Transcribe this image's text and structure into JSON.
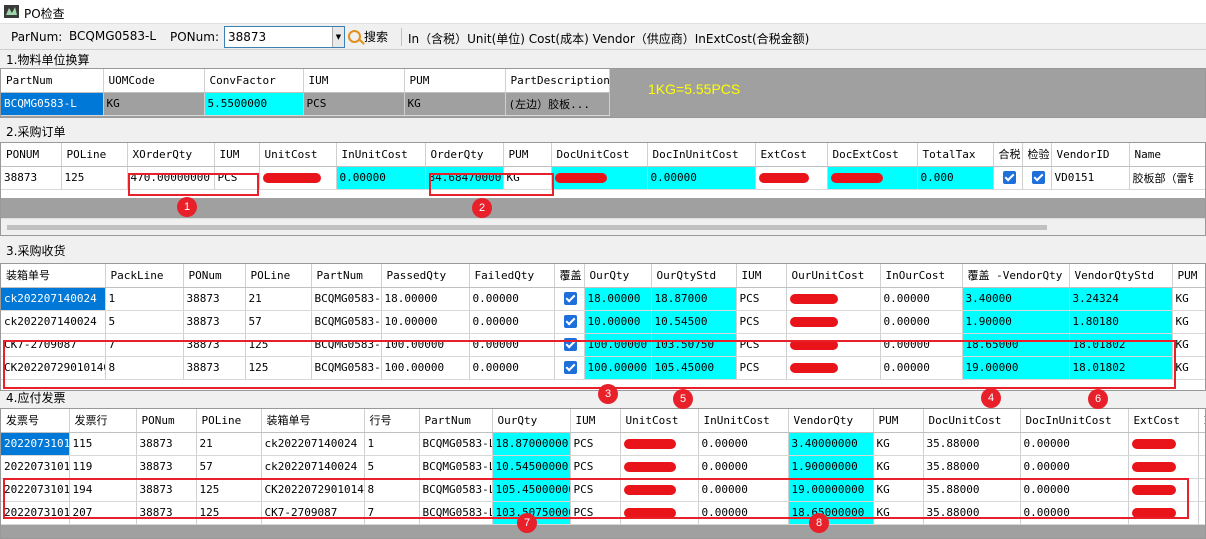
{
  "window": {
    "title": "PO检查"
  },
  "toolbar": {
    "parnum_label": "ParNum:",
    "parnum_value": "BCQMG0583-L",
    "ponum_label": "PONum:",
    "ponum_value": "38873",
    "search_label": "搜索",
    "legend": "In（含税）Unit(单位) Cost(成本) Vendor（供应商）InExtCost(合税金额)"
  },
  "uom": {
    "section": "1.物料单位换算",
    "headers": [
      "PartNum",
      "UOMCode",
      "ConvFactor",
      "IUM",
      "PUM",
      "PartDescription"
    ],
    "row": [
      "BCQMG0583-L",
      "KG",
      "5.5500000",
      "PCS",
      "KG",
      "(左边）胶板..."
    ],
    "note": "1KG=5.55PCS"
  },
  "po": {
    "section": "2.采购订单",
    "headers": [
      "PONUM",
      "POLine",
      "XOrderQty",
      "IUM",
      "UnitCost",
      "InUnitCost",
      "OrderQty",
      "PUM",
      "DocUnitCost",
      "DocInUnitCost",
      "ExtCost",
      "DocExtCost",
      "TotalTax",
      "合税",
      "检验",
      "VendorID",
      "Name"
    ],
    "row": [
      "38873",
      "125",
      "470.00000000",
      "PCS",
      "",
      "0.00000",
      "84.68470000",
      "KG",
      "",
      "0.00000",
      "",
      "",
      "0.000",
      "",
      "",
      "VD0151",
      "胶板部（雷钅"
    ]
  },
  "rcv": {
    "section": "3.采购收货",
    "headers": [
      "装箱单号",
      "PackLine",
      "PONum",
      "POLine",
      "PartNum",
      "PassedQty",
      "FailedQty",
      "覆盖",
      "OurQty",
      "OurQtyStd",
      "IUM",
      "OurUnitCost",
      "InOurCost",
      "覆盖 -VendorQty",
      "VendorQtyStd",
      "PUM"
    ],
    "rows": [
      [
        "ck202207140024",
        "1",
        "38873",
        "21",
        "BCQMG0583-L",
        "18.00000",
        "0.00000",
        "",
        "18.00000",
        "18.87000",
        "PCS",
        "",
        "0.00000",
        "3.40000",
        "3.24324",
        "KG"
      ],
      [
        "ck202207140024",
        "5",
        "38873",
        "57",
        "BCQMG0583-L",
        "10.00000",
        "0.00000",
        "",
        "10.00000",
        "10.54500",
        "PCS",
        "",
        "0.00000",
        "1.90000",
        "1.80180",
        "KG"
      ],
      [
        "CK7-2709087",
        "7",
        "38873",
        "125",
        "BCQMG0583-L",
        "100.00000",
        "0.00000",
        "",
        "100.00000",
        "103.50750",
        "PCS",
        "",
        "0.00000",
        "18.65000",
        "18.01802",
        "KG"
      ],
      [
        "CK20220729010140",
        "8",
        "38873",
        "125",
        "BCQMG0583-L",
        "100.00000",
        "0.00000",
        "",
        "100.00000",
        "105.45000",
        "PCS",
        "",
        "0.00000",
        "19.00000",
        "18.01802",
        "KG"
      ]
    ]
  },
  "inv": {
    "section": "4.应付发票",
    "headers": [
      "发票号",
      "发票行",
      "PONum",
      "POLine",
      "装箱单号",
      "行号",
      "PartNum",
      "OurQty",
      "IUM",
      "UnitCost",
      "InUnitCost",
      "VendorQty",
      "PUM",
      "DocUnitCost",
      "DocInUnitCost",
      "ExtCost",
      "In"
    ],
    "rows": [
      [
        "2022073101",
        "115",
        "38873",
        "21",
        "ck202207140024",
        "1",
        "BCQMG0583-L",
        "18.87000000",
        "PCS",
        "",
        "0.00000",
        "3.40000000",
        "KG",
        "35.88000",
        "0.00000",
        "",
        ""
      ],
      [
        "2022073101",
        "119",
        "38873",
        "57",
        "ck202207140024",
        "5",
        "BCQMG0583-L",
        "10.54500000",
        "PCS",
        "",
        "0.00000",
        "1.90000000",
        "KG",
        "35.88000",
        "0.00000",
        "",
        ""
      ],
      [
        "2022073101",
        "194",
        "38873",
        "125",
        "CK20220729010140",
        "8",
        "BCQMG0583-L",
        "105.45000000",
        "PCS",
        "",
        "0.00000",
        "19.00000000",
        "KG",
        "35.88000",
        "0.00000",
        "",
        ""
      ],
      [
        "2022073101",
        "207",
        "38873",
        "125",
        "CK7-2709087",
        "7",
        "BCQMG0583-L",
        "103.50750000",
        "PCS",
        "",
        "0.00000",
        "18.65000000",
        "KG",
        "35.88000",
        "0.00000",
        "",
        ""
      ]
    ]
  },
  "markers": [
    "1",
    "2",
    "3",
    "4",
    "5",
    "6",
    "7",
    "8"
  ]
}
